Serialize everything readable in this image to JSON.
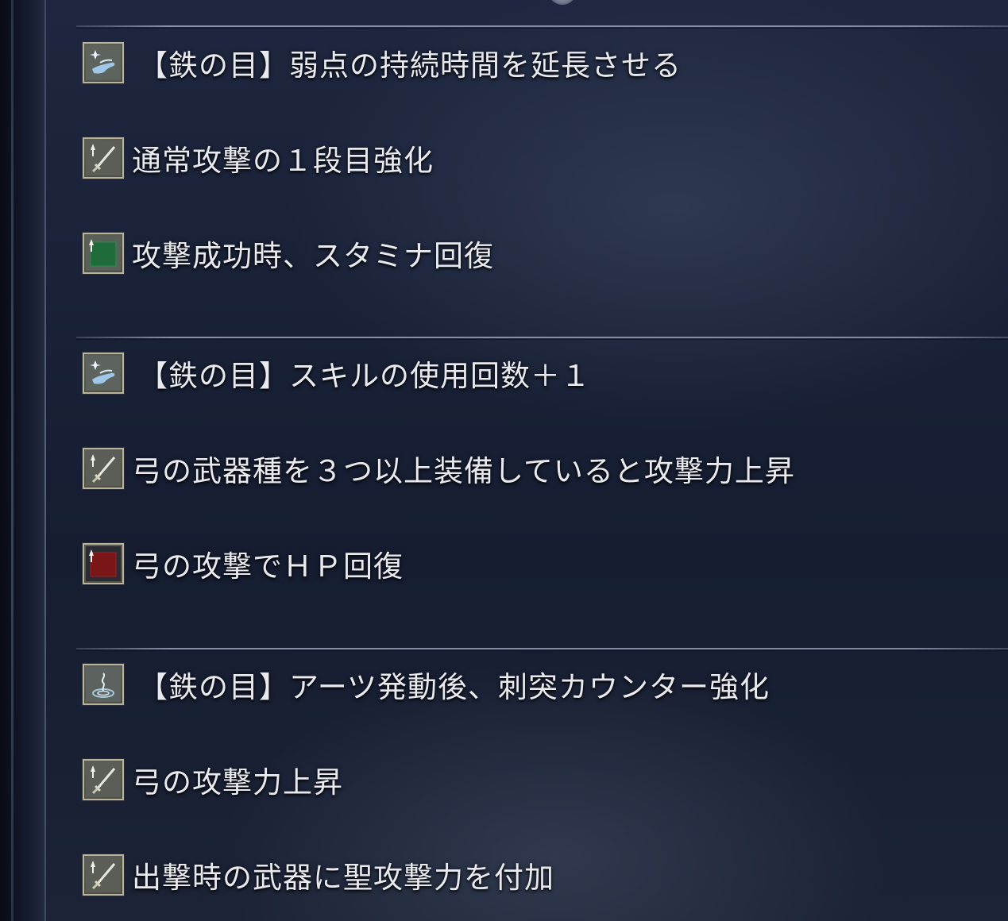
{
  "groups": [
    {
      "items": [
        {
          "icon": "eye-skill-icon",
          "text": "【鉄の目】弱点の持続時間を延長させる"
        },
        {
          "icon": "sword-upgrade-icon",
          "text": "通常攻撃の１段目強化"
        },
        {
          "icon": "green-upgrade-icon",
          "text": "攻撃成功時、スタミナ回復"
        }
      ]
    },
    {
      "items": [
        {
          "icon": "eye-skill-icon",
          "text": "【鉄の目】スキルの使用回数＋１"
        },
        {
          "icon": "sword-upgrade-icon",
          "text": "弓の武器種を３つ以上装備していると攻撃力上昇"
        },
        {
          "icon": "red-upgrade-icon",
          "text": "弓の攻撃でＨＰ回復"
        }
      ]
    },
    {
      "items": [
        {
          "icon": "arts-icon",
          "text": "【鉄の目】アーツ発動後、刺突カウンター強化"
        },
        {
          "icon": "sword-upgrade-icon",
          "text": "弓の攻撃力上昇"
        },
        {
          "icon": "sword-upgrade-icon",
          "text": "出撃時の武器に聖攻撃力を付加"
        }
      ]
    }
  ],
  "colors": {
    "text": "#e8eaef",
    "icon_border": "#b9b39a",
    "green_fill": "#1f6b3a",
    "red_fill": "#7a1518"
  }
}
